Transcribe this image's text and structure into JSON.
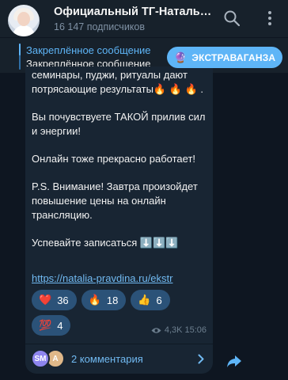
{
  "header": {
    "title": "Официальный ТГ-Натальи...",
    "subscribers": "16 147 подписчиков"
  },
  "pinned": {
    "label": "Закреплённое сообщение",
    "text": "Закреплённое сообщение",
    "button_emoji": "🔮",
    "button_label": "ЭКСТРАВАГАНЗА"
  },
  "message": {
    "paragraphs": [
      "семинары, пуджи, ритуалы дают потрясающие результаты🔥 🔥 🔥 .",
      "Вы почувствуете ТАКОЙ прилив сил и энергии!",
      "Онлайн тоже прекрасно работает!",
      "P.S. Внимание! Завтра произойдет повышение цены на онлайн трансляцию.",
      "Успевайте записаться ⬇️⬇️⬇️"
    ],
    "link": "https://natalia-pravdina.ru/ekstr",
    "reactions": [
      {
        "emoji": "❤️",
        "count": "36"
      },
      {
        "emoji": "🔥",
        "count": "18"
      },
      {
        "emoji": "👍",
        "count": "6"
      },
      {
        "emoji": "💯",
        "count": "4"
      }
    ],
    "views": "4,3K",
    "time": "15:06"
  },
  "comments": {
    "avatar1": "SM",
    "avatar2": "A",
    "label": "2 комментария"
  },
  "colors": {
    "background": "#0e1621",
    "bar": "#17212b",
    "bubble": "#182533",
    "accent": "#5eb5f7",
    "reaction": "#2b5278"
  }
}
